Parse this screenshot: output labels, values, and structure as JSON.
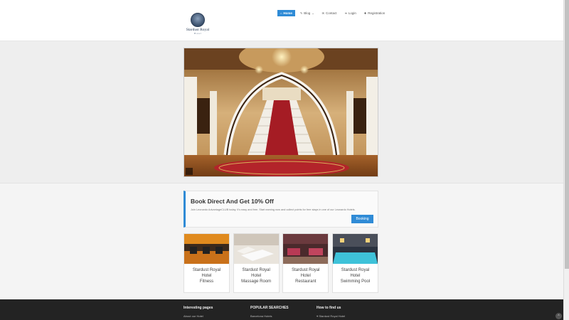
{
  "brand": {
    "name": "Stardust Royal",
    "sub": "Hotel"
  },
  "nav": [
    {
      "label": "Home",
      "icon": "⌂"
    },
    {
      "label": "Blog",
      "icon": "✎"
    },
    {
      "label": "Contact",
      "icon": "✉"
    },
    {
      "label": "Login",
      "icon": "➜"
    },
    {
      "label": "Registration",
      "icon": "✚"
    }
  ],
  "promo": {
    "title": "Book Direct And Get 10% Off",
    "text": "Join Leonardo AdvantageCLUB today. It's easy and free. Start earning now and collect points for free stays in one of our Leonardo Hotels.",
    "button": "Booking"
  },
  "cards": [
    {
      "line1": "Stardust Royal",
      "line2": "Hotel",
      "line3": "Fitness"
    },
    {
      "line1": "Stardust Royal",
      "line2": "Hotel",
      "line3": "Massage Room"
    },
    {
      "line1": "Stardust Royal",
      "line2": "Hotel",
      "line3": "Restaurant"
    },
    {
      "line1": "Stardust Royal",
      "line2": "Hotel",
      "line3": "Swimming Pool"
    }
  ],
  "footer": {
    "col1": {
      "heading": "Interesting pages",
      "link": "About our Hotel"
    },
    "col2": {
      "heading": "POPULAR SEARCHES",
      "link": "Barcelona Hotels"
    },
    "col3": {
      "heading": "How to find us",
      "link": "Stardust Royal Hotel"
    }
  },
  "colors": {
    "accent": "#2f8bd6",
    "footer": "#232323"
  }
}
